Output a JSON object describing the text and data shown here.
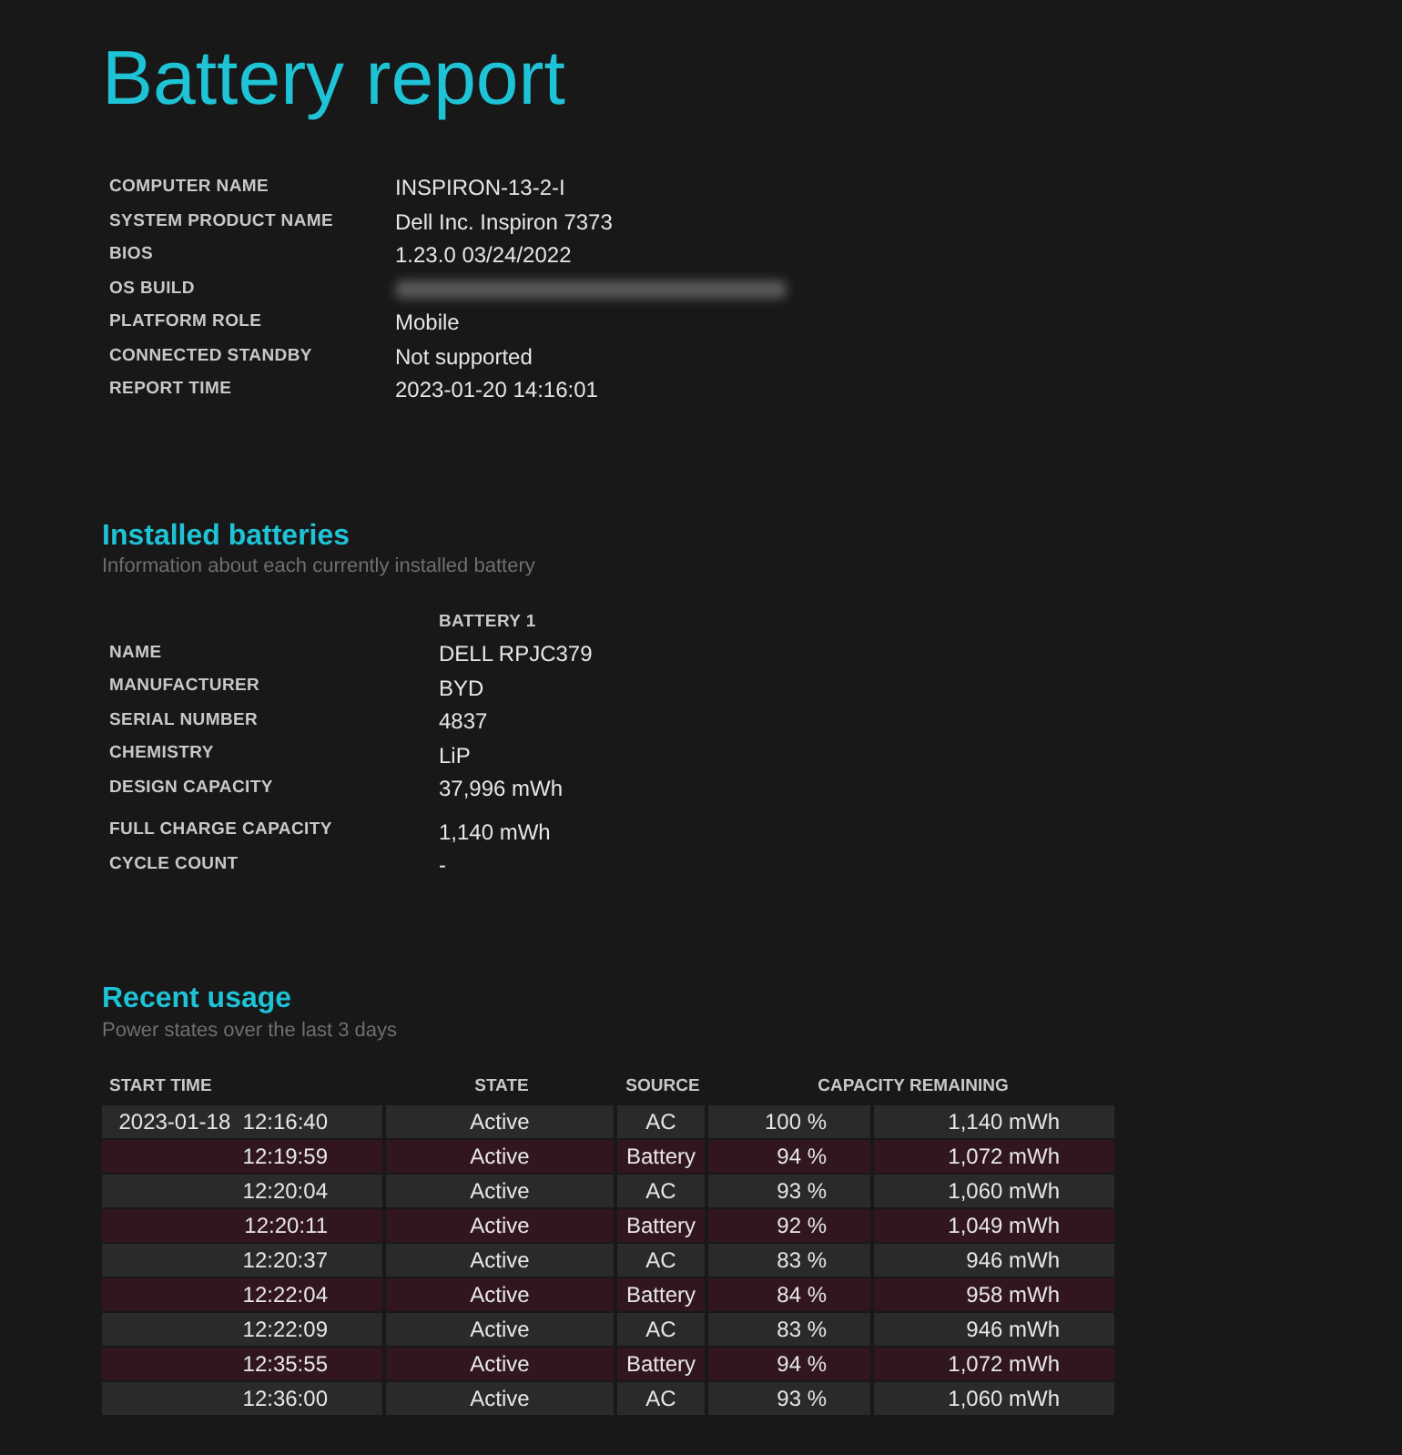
{
  "title": "Battery report",
  "system_info": [
    {
      "label": "COMPUTER NAME",
      "value": "INSPIRON-13-2-I",
      "redacted": false
    },
    {
      "label": "SYSTEM PRODUCT NAME",
      "value": "Dell Inc. Inspiron 7373",
      "redacted": false
    },
    {
      "label": "BIOS",
      "value": "1.23.0 03/24/2022",
      "redacted": false
    },
    {
      "label": "OS BUILD",
      "redacted": true
    },
    {
      "label": "PLATFORM ROLE",
      "value": "Mobile",
      "redacted": false
    },
    {
      "label": "CONNECTED STANDBY",
      "value": "Not supported",
      "redacted": false
    },
    {
      "label": "REPORT TIME",
      "value": "2023-01-20  14:16:01",
      "redacted": false
    }
  ],
  "installed_batteries": {
    "heading": "Installed batteries",
    "subtitle": "Information about each currently installed battery",
    "column": "BATTERY 1",
    "rows": [
      {
        "label": "NAME",
        "value": "DELL RPJC379"
      },
      {
        "label": "MANUFACTURER",
        "value": "BYD"
      },
      {
        "label": "SERIAL NUMBER",
        "value": "4837"
      },
      {
        "label": "CHEMISTRY",
        "value": "LiP"
      },
      {
        "label": "DESIGN CAPACITY",
        "value": "37,996 mWh"
      },
      {
        "label": "FULL CHARGE CAPACITY",
        "value": "1,140 mWh"
      },
      {
        "label": "CYCLE COUNT",
        "value": "-"
      }
    ]
  },
  "recent_usage": {
    "heading": "Recent usage",
    "subtitle": "Power states over the last 3 days",
    "columns": [
      "START TIME",
      "STATE",
      "SOURCE",
      "CAPACITY REMAINING"
    ],
    "rows": [
      {
        "kind": "ac",
        "date": "2023-01-18",
        "time": "12:16:40",
        "state": "Active",
        "source": "AC",
        "percent": "100 %",
        "capacity": "1,140 mWh"
      },
      {
        "kind": "battery",
        "time": "12:19:59",
        "state": "Active",
        "source": "Battery",
        "percent": "94 %",
        "capacity": "1,072 mWh"
      },
      {
        "kind": "ac",
        "time": "12:20:04",
        "state": "Active",
        "source": "AC",
        "percent": "93 %",
        "capacity": "1,060 mWh"
      },
      {
        "kind": "battery",
        "time": "12:20:11",
        "state": "Active",
        "source": "Battery",
        "percent": "92 %",
        "capacity": "1,049 mWh"
      },
      {
        "kind": "ac",
        "time": "12:20:37",
        "state": "Active",
        "source": "AC",
        "percent": "83 %",
        "capacity": "946 mWh"
      },
      {
        "kind": "battery",
        "time": "12:22:04",
        "state": "Active",
        "source": "Battery",
        "percent": "84 %",
        "capacity": "958 mWh"
      },
      {
        "kind": "ac",
        "time": "12:22:09",
        "state": "Active",
        "source": "AC",
        "percent": "83 %",
        "capacity": "946 mWh"
      },
      {
        "kind": "battery",
        "time": "12:35:55",
        "state": "Active",
        "source": "Battery",
        "percent": "94 %",
        "capacity": "1,072 mWh"
      },
      {
        "kind": "ac",
        "time": "12:36:00",
        "state": "Active",
        "source": "AC",
        "percent": "93 %",
        "capacity": "1,060 mWh"
      }
    ]
  }
}
